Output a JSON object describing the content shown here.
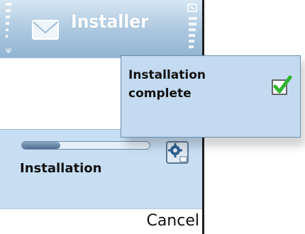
{
  "app": {
    "title": "Installer",
    "icon": "envelope-icon"
  },
  "status": {
    "signal_icon": "signal-bars-icon",
    "battery_icon": "battery-icon"
  },
  "progress": {
    "label": "Installation",
    "value": 0.3,
    "icon": "install-gear-icon"
  },
  "softkeys": {
    "right": "Cancel"
  },
  "notification": {
    "message": "Installation complete",
    "icon": "checkmark-icon"
  },
  "colors": {
    "title_bar": "#a9c6df",
    "panel": "#c8def3",
    "check": "#2fb52f"
  }
}
